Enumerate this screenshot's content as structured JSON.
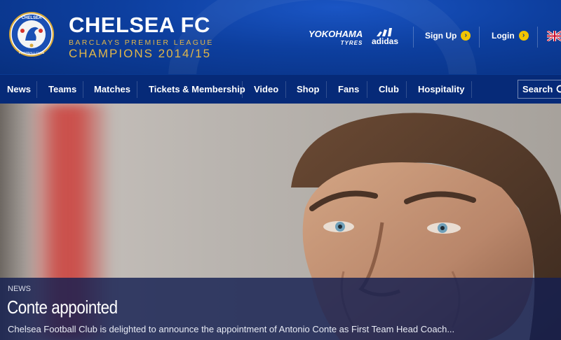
{
  "brand": {
    "name": "CHELSEA FC",
    "league": "BARCLAYS PREMIER LEAGUE",
    "champions": "CHAMPIONS 2014/15",
    "crest_text": "CHELSEA",
    "crest_sub": "FOOTBALL CLUB"
  },
  "sponsors": {
    "yokohama": "YOKOHAMA",
    "yokohama_sub": "TYRES",
    "adidas": "adidas"
  },
  "account": {
    "signup": "Sign Up",
    "login": "Login"
  },
  "nav": {
    "items": [
      "News",
      "Teams",
      "Matches",
      "Tickets & Membership",
      "Video",
      "Shop",
      "Fans",
      "Club",
      "Hospitality"
    ],
    "search": "Search"
  },
  "hero": {
    "kicker": "NEWS",
    "title": "Conte appointed",
    "summary": "Chelsea Football Club is delighted to announce the appointment of Antonio Conte as First Team Head Coach..."
  },
  "colors": {
    "brand_blue": "#0b3a8f",
    "nav_blue": "#062a78",
    "gold": "#e1b64a",
    "arrow_yellow": "#f1c400"
  },
  "icons": {
    "crest": "chelsea-crest-icon",
    "search": "search-icon",
    "arrow": "arrow-right-circle-icon",
    "flag": "uk-flag-icon"
  }
}
